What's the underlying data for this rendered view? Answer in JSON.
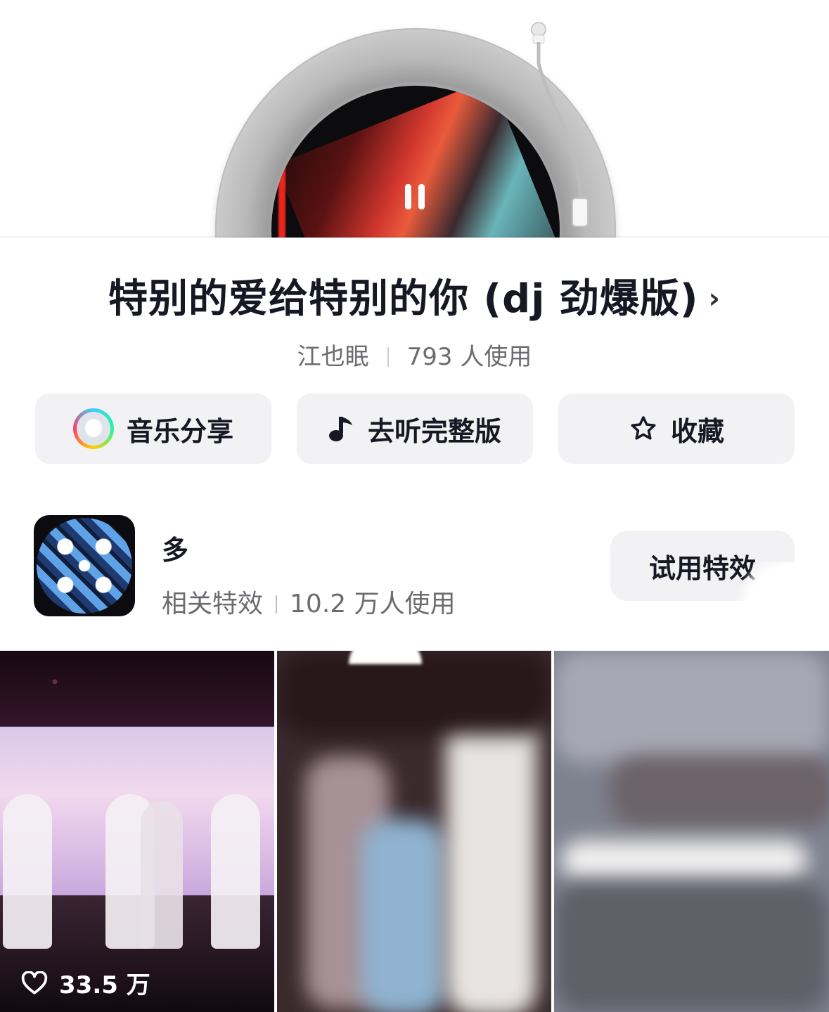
{
  "song": {
    "title": "特别的爱给特别的你 (dj 劲爆版)",
    "chevron": "›",
    "artist": "江也眠",
    "usage": "793 人使用"
  },
  "actions": {
    "share_label": "音乐分享",
    "listen_label": "去听完整版",
    "favorite_label": "收藏"
  },
  "effect": {
    "name": "多",
    "category": "相关特效",
    "usage": "10.2 万人使用",
    "try_label": "试用特效"
  },
  "videos": [
    {
      "likes": "33.5 万"
    }
  ],
  "icons": {
    "pause": "pause-icon",
    "music_note": "music-note-icon",
    "star": "star-icon",
    "heart": "heart-icon"
  }
}
